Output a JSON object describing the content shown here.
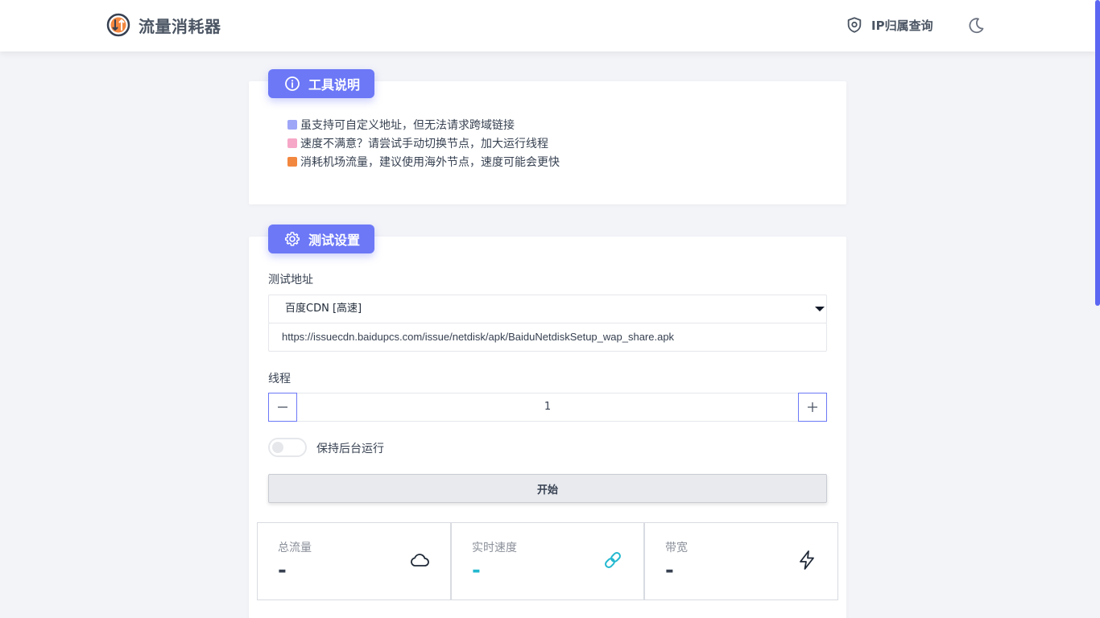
{
  "header": {
    "title": "流量消耗器",
    "ip_link": "IP归属查询"
  },
  "info": {
    "badge": "工具说明",
    "tips": [
      {
        "text": "虽支持可自定义地址，但无法请求跨域链接",
        "color": "#9ea6f7"
      },
      {
        "text": "速度不满意？请尝试手动切换节点，加大运行线程",
        "color": "#f6a7c7"
      },
      {
        "text": "消耗机场流量，建议使用海外节点，速度可能会更快",
        "color": "#f2873f"
      }
    ]
  },
  "settings": {
    "badge": "测试设置",
    "url_label": "测试地址",
    "selected_node": "百度CDN [高速]",
    "url_value": "https://issuecdn.baidupcs.com/issue/netdisk/apk/BaiduNetdiskSetup_wap_share.apk",
    "threads_label": "线程",
    "threads_value": "1",
    "background_label": "保持后台运行",
    "background_on": false,
    "start_label": "开始"
  },
  "stats": [
    {
      "title": "总流量",
      "value": "-",
      "icon": "cloud-icon",
      "color": "#374151"
    },
    {
      "title": "实时速度",
      "value": "-",
      "icon": "link-icon",
      "color": "#22b8cf"
    },
    {
      "title": "带宽",
      "value": "-",
      "icon": "lightning-icon",
      "color": "#374151"
    }
  ],
  "colors": {
    "accent": "#6c78f6",
    "speed": "#22b8cf"
  }
}
